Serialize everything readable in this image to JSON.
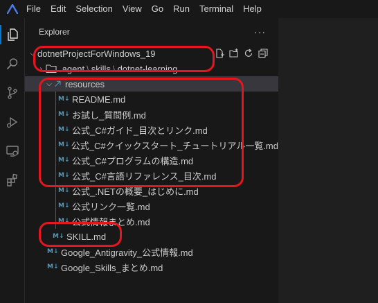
{
  "menu": [
    "File",
    "Edit",
    "Selection",
    "View",
    "Go",
    "Run",
    "Terminal",
    "Help"
  ],
  "activity_bar": [
    "explorer-icon",
    "search-icon",
    "source-control-icon",
    "run-debug-icon",
    "remote-explorer-icon",
    "extensions-icon"
  ],
  "sidebar": {
    "title": "Explorer",
    "more": "···",
    "workspace": "dotnetProjectForWindows_19",
    "path": {
      "segments": [
        ".agent",
        "skills",
        "dotnet-learning"
      ],
      "separator": "\\"
    },
    "resources_folder": "resources",
    "resources_files": [
      "README.md",
      "お試し_質問例.md",
      "公式_C#ガイド_目次とリンク.md",
      "公式_C#クイックスタート_チュートリアル一覧.md",
      "公式_C#プログラムの構造.md",
      "公式_C#言語リファレンス_目次.md",
      "公式_.NETの概要_はじめに.md",
      "公式リンク一覧.md",
      "公式情報まとめ.md"
    ],
    "skill_file": "SKILL.md",
    "root_files": [
      "Google_Antigravity_公式情報.md",
      "Google_Skills_まとめ.md"
    ],
    "md_glyph": "M↓"
  },
  "colors": {
    "annotation": "#e5161f",
    "accent": "#0078d4",
    "md_icon": "#519aba",
    "selected_row": "#37373d"
  }
}
